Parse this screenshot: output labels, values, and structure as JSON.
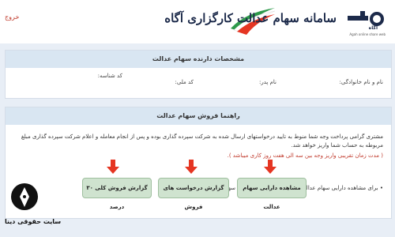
{
  "header": {
    "exit_label": "خروج",
    "portal_title": "سامانه سهام عدالت کارگزاری آگاه",
    "logo_text": "آگاه",
    "logo_subtitle": "Agah online share web",
    "colors": {
      "brand": "#1c2a4a",
      "accent_red": "#e53522",
      "accent_green": "#2e9a4b"
    }
  },
  "holder_panel": {
    "title": "مشخصات دارنده سهام عدالت",
    "fields": {
      "name": "نام و نام خانوادگی:",
      "father_name": "نام پدر:",
      "national_id": "کد ملی:",
      "share_code": "کد شناسه:"
    }
  },
  "guide_panel": {
    "title": "راهنما فروش سهام عدالت",
    "paragraph": "مشتری گرامی پرداخت وجه شما منوط به تایید درخواستهای ارسال شده به شرکت سپرده گذاری بوده و پس از انجام معامله و اعلام شرکت سپرده گذاری مبلغ مربوطه به حساب شما واریز خواهد شد.",
    "note": "( مدت زمان تقریبی واریز وجه بین سه الی هفت روز کاری میباشد ).",
    "instruction": "برای مشاهده دارایی سهام عدالت خود گزینه «مشاهده دارایی سهام عدالت» را انتخاب نمایید."
  },
  "actions": {
    "view_assets": "مشاهده دارایی سهام عدالت",
    "sell_requests_report": "گزارش درخواست های فروش",
    "total_sale_report": "گزارش فروش کلی ۳۰ درصد"
  },
  "watermark": {
    "text": "سایت حقوقی دینا"
  }
}
